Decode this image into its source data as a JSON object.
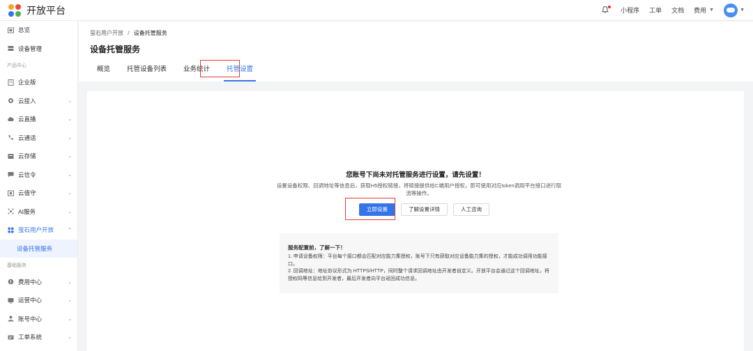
{
  "topbar": {
    "app_name": "开放平台",
    "links": [
      "小程序",
      "工单",
      "文档"
    ],
    "billing": "费用",
    "brand_colors": [
      "#f5a623",
      "#e94b3c",
      "#3574e8",
      "#4caf50"
    ]
  },
  "sidebar": {
    "items_top": [
      {
        "label": "总览",
        "icon": "dashboard-icon"
      },
      {
        "label": "设备管理",
        "icon": "device-list-icon"
      }
    ],
    "section_product": "产品中心",
    "items_product": [
      {
        "label": "企业版",
        "icon": "building-icon",
        "chevron": false
      },
      {
        "label": "云接入",
        "icon": "cloud-access-icon",
        "chevron": true
      },
      {
        "label": "云直播",
        "icon": "cloud-live-icon",
        "chevron": true
      },
      {
        "label": "云通话",
        "icon": "phone-icon",
        "chevron": true
      },
      {
        "label": "云存储",
        "icon": "storage-icon",
        "chevron": true
      },
      {
        "label": "云信令",
        "icon": "message-icon",
        "chevron": true
      },
      {
        "label": "云值守",
        "icon": "camera-icon",
        "chevron": true
      },
      {
        "label": "AI服务",
        "icon": "ai-icon",
        "chevron": true
      }
    ],
    "active_parent": {
      "label": "萤石用户开放",
      "icon": "grid-icon"
    },
    "active_sub": "设备托管服务",
    "section_basic": "基础服务",
    "items_basic": [
      {
        "label": "费用中心",
        "icon": "coin-icon",
        "chevron": true
      },
      {
        "label": "运营中心",
        "icon": "operations-icon",
        "chevron": true
      },
      {
        "label": "账号中心",
        "icon": "user-icon",
        "chevron": true
      },
      {
        "label": "工单系统",
        "icon": "ticket-icon",
        "chevron": true
      }
    ]
  },
  "breadcrumb": {
    "parent": "萤石用户开放",
    "separator": "/",
    "current": "设备托管服务"
  },
  "page_title": "设备托管服务",
  "tabs": [
    {
      "label": "概览",
      "active": false
    },
    {
      "label": "托管设备列表",
      "active": false
    },
    {
      "label": "业务统计",
      "active": false
    },
    {
      "label": "托管设置",
      "active": true
    }
  ],
  "empty_state": {
    "title": "您账号下尚未对托管服务进行设置，请先设置！",
    "description": "设置设备权限、回调地址等信息后，获取H5授权链接，将链接提供给C端用户授权，即可使用对应token调用平台接口进行取流等操作。",
    "primary_button": "立即设置",
    "secondary_button": "了解设置详情",
    "tertiary_button": "人工咨询"
  },
  "tips": {
    "heading": "服务配置前，了解一下！",
    "lines": [
      "1. 申请设备权限：平台每个接口都会匹配对应能力集授权，账号下只有获取对应设备能力集的授权，才能成功调用功能接口。",
      "2. 回调地址：地址协议形式为 HTTPS/HTTP，同时整个请求回调地址由开发者自定义。开放平台会通过这个回调地址，将授权码等信息给到开发者，最后开发者向平台返回成功信息。"
    ]
  },
  "accent_color": "#3574e8",
  "highlight_color": "#e53935"
}
